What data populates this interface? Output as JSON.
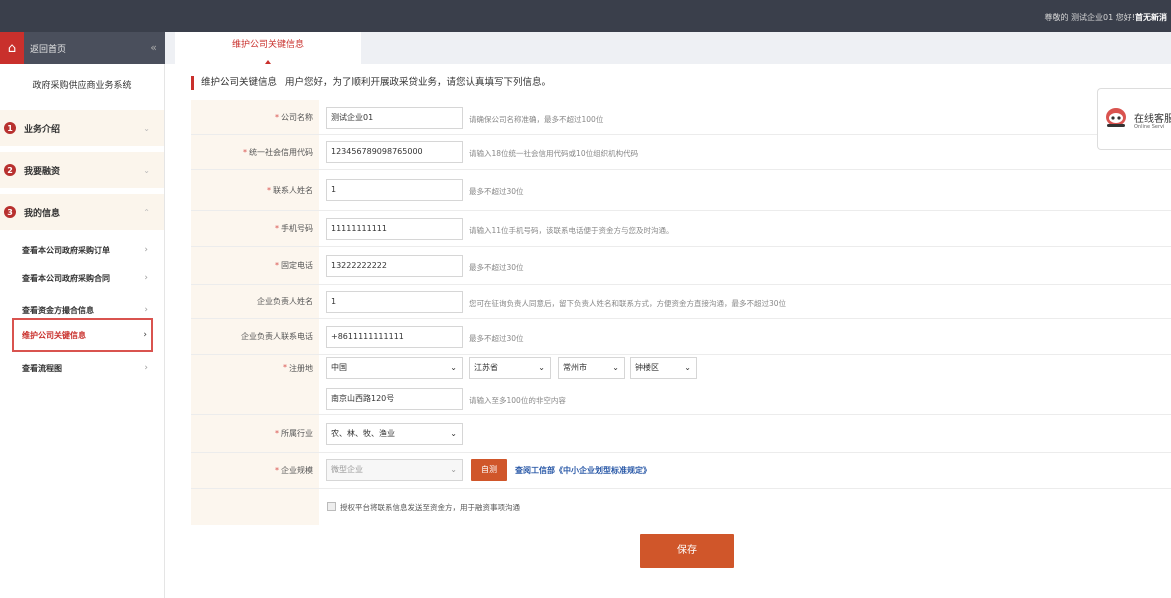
{
  "topbar": {
    "greeting": "尊敬的 测试企业01 您好!",
    "bold_text": "首无新消"
  },
  "sidebar": {
    "home_label": "返回首页",
    "collapse_icon": "«",
    "system_title": "政府采购供应商业务系统",
    "groups": [
      {
        "num": "1",
        "label": "业务介绍",
        "arrow": "⌄"
      },
      {
        "num": "2",
        "label": "我要融资",
        "arrow": "⌄"
      },
      {
        "num": "3",
        "label": "我的信息",
        "arrow": "⌃"
      }
    ],
    "sub_items": [
      {
        "label": "查看本公司政府采购订单",
        "arrow": "›"
      },
      {
        "label": "查看本公司政府采购合同",
        "arrow": "›"
      },
      {
        "label": "查看资金方撮合信息",
        "arrow": "›"
      },
      {
        "label": "维护公司关键信息",
        "arrow": "›"
      },
      {
        "label": "查看流程图",
        "arrow": "›"
      }
    ]
  },
  "tab": {
    "label": "维护公司关键信息"
  },
  "section": {
    "title": "维护公司关键信息",
    "description": "用户您好，为了顺利开展政采贷业务，请您认真填写下列信息。"
  },
  "form": {
    "company_name": {
      "label": "公司名称",
      "value": "测试企业01",
      "hint": "请确保公司名称准确，最多不超过100位"
    },
    "credit_code": {
      "label": "统一社会信用代码",
      "value": "123456789098765000",
      "hint": "请输入18位统一社会信用代码或10位组织机构代码"
    },
    "contact_name": {
      "label": "联系人姓名",
      "value": "1",
      "hint": "最多不超过30位"
    },
    "phone": {
      "label": "手机号码",
      "value": "11111111111",
      "hint": "请输入11位手机号码，该联系电话便于资金方与您及时沟通。"
    },
    "landline": {
      "label": "固定电话",
      "value": "13222222222",
      "hint": "最多不超过30位"
    },
    "legal_name": {
      "label": "企业负责人姓名",
      "value": "1",
      "hint": "您可在征询负责人同意后，留下负责人姓名和联系方式，方便资金方直接沟通，最多不超过30位"
    },
    "legal_phone": {
      "label": "企业负责人联系电话",
      "value": "+8611111111111",
      "hint": "最多不超过30位"
    },
    "address": {
      "label": "注册地",
      "country": "中国",
      "province": "江苏省",
      "city": "常州市",
      "district": "钟楼区",
      "street": "南京山西路120号",
      "hint": "请输入至多100位的非空内容"
    },
    "industry": {
      "label": "所属行业",
      "value": "农、林、牧、渔业"
    },
    "scale": {
      "label": "企业规模",
      "value": "微型企业",
      "button": "自测",
      "link": "查阅工信部《中小企业划型标准规定》"
    },
    "authorize_text": "授权平台将联系信息发送至资金方，用于融资事项沟通",
    "save_button": "保存"
  },
  "online_service": {
    "title": "在线客服",
    "subtitle": "Online Servi"
  },
  "colors": {
    "accent": "#c9302c",
    "button": "#d0562a",
    "label_bg": "#fcf6ee",
    "topbar": "#3a3f4b"
  }
}
